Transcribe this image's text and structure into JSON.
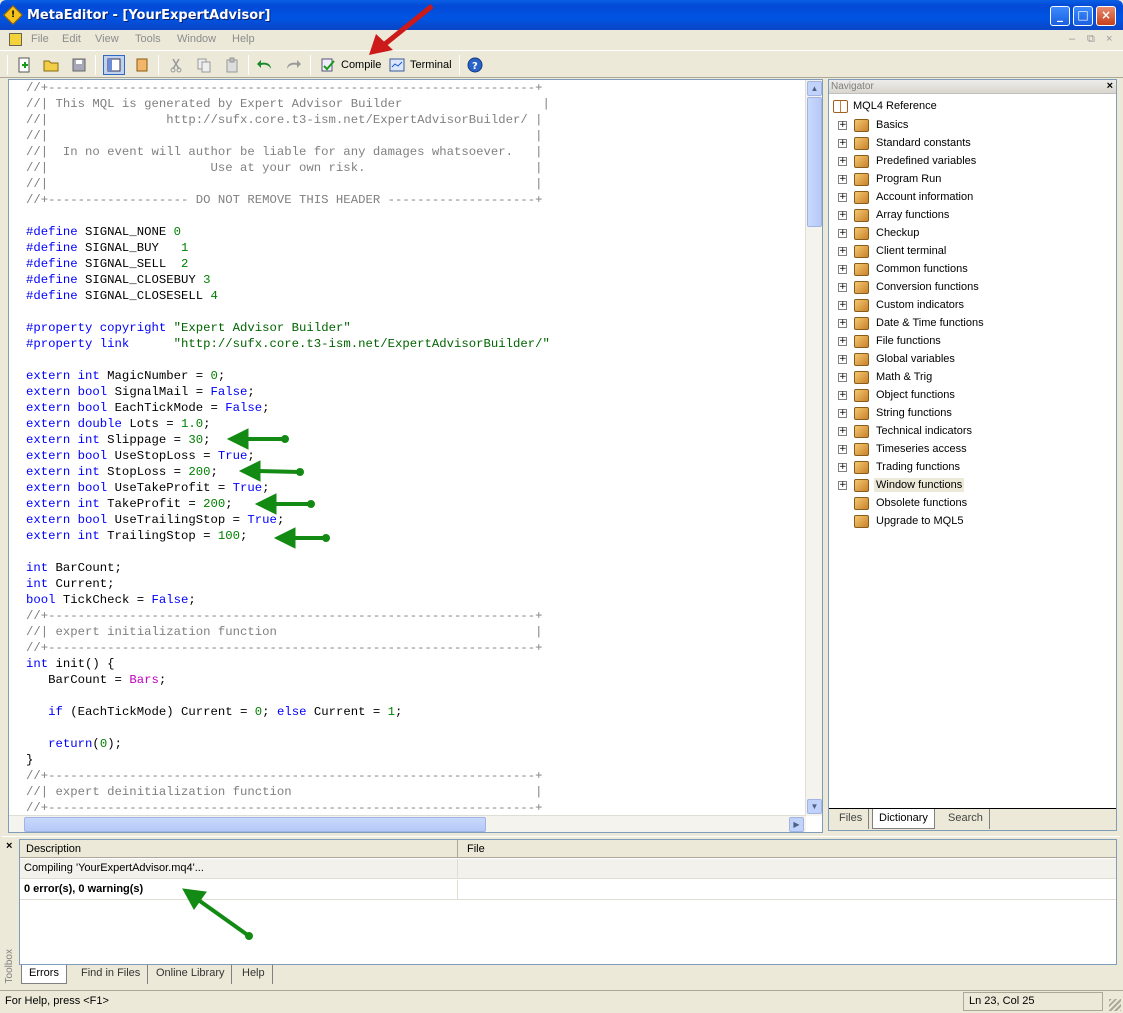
{
  "window": {
    "title": "MetaEditor - [YourExpertAdvisor]",
    "controls": [
      "_",
      "□",
      "×"
    ]
  },
  "menu": {
    "items": [
      "File",
      "Edit",
      "View",
      "Tools",
      "Window",
      "Help"
    ],
    "mdi_controls": [
      "–",
      "⧉",
      "×"
    ]
  },
  "toolbar": {
    "compile_label": "Compile",
    "terminal_label": "Terminal"
  },
  "editor": {
    "lines": [
      [
        [
          "cmt",
          "//+------------------------------------------------------------------+"
        ]
      ],
      [
        [
          "cmt",
          "//| This MQL is generated by Expert Advisor Builder                   |"
        ]
      ],
      [
        [
          "cmt",
          "//|                http://sufx.core.t3-ism.net/ExpertAdvisorBuilder/ |"
        ]
      ],
      [
        [
          "cmt",
          "//|                                                                  |"
        ]
      ],
      [
        [
          "cmt",
          "//|  In no event will author be liable for any damages whatsoever.   |"
        ]
      ],
      [
        [
          "cmt",
          "//|                      Use at your own risk.                       |"
        ]
      ],
      [
        [
          "cmt",
          "//|                                                                  |"
        ]
      ],
      [
        [
          "cmt",
          "//+------------------- DO NOT REMOVE THIS HEADER --------------------+"
        ]
      ],
      [],
      [
        [
          "pre",
          "#define"
        ],
        [
          "",
          " SIGNAL_NONE "
        ],
        [
          "num",
          "0"
        ]
      ],
      [
        [
          "pre",
          "#define"
        ],
        [
          "",
          " SIGNAL_BUY   "
        ],
        [
          "num",
          "1"
        ]
      ],
      [
        [
          "pre",
          "#define"
        ],
        [
          "",
          " SIGNAL_SELL  "
        ],
        [
          "num",
          "2"
        ]
      ],
      [
        [
          "pre",
          "#define"
        ],
        [
          "",
          " SIGNAL_CLOSEBUY "
        ],
        [
          "num",
          "3"
        ]
      ],
      [
        [
          "pre",
          "#define"
        ],
        [
          "",
          " SIGNAL_CLOSESELL "
        ],
        [
          "num",
          "4"
        ]
      ],
      [],
      [
        [
          "pre",
          "#property copyright"
        ],
        [
          "",
          " "
        ],
        [
          "str",
          "\"Expert Advisor Builder\""
        ]
      ],
      [
        [
          "pre",
          "#property link"
        ],
        [
          "",
          "      "
        ],
        [
          "str",
          "\"http://sufx.core.t3-ism.net/ExpertAdvisorBuilder/\""
        ]
      ],
      [],
      [
        [
          "kw",
          "extern int"
        ],
        [
          "",
          " MagicNumber = "
        ],
        [
          "num",
          "0"
        ],
        [
          "",
          ";"
        ]
      ],
      [
        [
          "kw",
          "extern bool"
        ],
        [
          "",
          " SignalMail = "
        ],
        [
          "bool",
          "False"
        ],
        [
          "",
          ";"
        ]
      ],
      [
        [
          "kw",
          "extern bool"
        ],
        [
          "",
          " EachTickMode = "
        ],
        [
          "bool",
          "False"
        ],
        [
          "",
          ";"
        ]
      ],
      [
        [
          "kw",
          "extern double"
        ],
        [
          "",
          " Lots = "
        ],
        [
          "num",
          "1.0"
        ],
        [
          "",
          ";"
        ]
      ],
      [
        [
          "kw",
          "extern int"
        ],
        [
          "",
          " Slippage = "
        ],
        [
          "num",
          "30"
        ],
        [
          "",
          ";"
        ]
      ],
      [
        [
          "kw",
          "extern bool"
        ],
        [
          "",
          " UseStopLoss = "
        ],
        [
          "bool",
          "True"
        ],
        [
          "",
          ";"
        ]
      ],
      [
        [
          "kw",
          "extern int"
        ],
        [
          "",
          " StopLoss = "
        ],
        [
          "num",
          "200"
        ],
        [
          "",
          ";"
        ]
      ],
      [
        [
          "kw",
          "extern bool"
        ],
        [
          "",
          " UseTakeProfit = "
        ],
        [
          "bool",
          "True"
        ],
        [
          "",
          ";"
        ]
      ],
      [
        [
          "kw",
          "extern int"
        ],
        [
          "",
          " TakeProfit = "
        ],
        [
          "num",
          "200"
        ],
        [
          "",
          ";"
        ]
      ],
      [
        [
          "kw",
          "extern bool"
        ],
        [
          "",
          " UseTrailingStop = "
        ],
        [
          "bool",
          "True"
        ],
        [
          "",
          ";"
        ]
      ],
      [
        [
          "kw",
          "extern int"
        ],
        [
          "",
          " TrailingStop = "
        ],
        [
          "num",
          "100"
        ],
        [
          "",
          ";"
        ]
      ],
      [],
      [
        [
          "kw",
          "int"
        ],
        [
          "",
          " BarCount;"
        ]
      ],
      [
        [
          "kw",
          "int"
        ],
        [
          "",
          " Current;"
        ]
      ],
      [
        [
          "kw",
          "bool"
        ],
        [
          "",
          " TickCheck = "
        ],
        [
          "bool",
          "False"
        ],
        [
          "",
          ";"
        ]
      ],
      [
        [
          "cmt",
          "//+------------------------------------------------------------------+"
        ]
      ],
      [
        [
          "cmt",
          "//| expert initialization function                                   |"
        ]
      ],
      [
        [
          "cmt",
          "//+------------------------------------------------------------------+"
        ]
      ],
      [
        [
          "kw",
          "int"
        ],
        [
          "",
          " init() {"
        ]
      ],
      [
        [
          "",
          "   BarCount = "
        ],
        [
          "var",
          "Bars"
        ],
        [
          "",
          ";"
        ]
      ],
      [],
      [
        [
          "",
          "   "
        ],
        [
          "kw",
          "if"
        ],
        [
          "",
          " (EachTickMode) Current = "
        ],
        [
          "num",
          "0"
        ],
        [
          "",
          "; "
        ],
        [
          "kw",
          "else"
        ],
        [
          "",
          " Current = "
        ],
        [
          "num",
          "1"
        ],
        [
          "",
          ";"
        ]
      ],
      [],
      [
        [
          "",
          "   "
        ],
        [
          "kw",
          "return"
        ],
        [
          "",
          "("
        ],
        [
          "num",
          "0"
        ],
        [
          "",
          ");"
        ]
      ],
      [
        [
          "",
          "}"
        ]
      ],
      [
        [
          "cmt",
          "//+------------------------------------------------------------------+"
        ]
      ],
      [
        [
          "cmt",
          "//| expert deinitialization function                                 |"
        ]
      ],
      [
        [
          "cmt",
          "//+------------------------------------------------------------------+"
        ]
      ]
    ]
  },
  "navigator": {
    "title": "Navigator",
    "root": "MQL4 Reference",
    "items": [
      {
        "label": "Basics",
        "expandable": true
      },
      {
        "label": "Standard constants",
        "expandable": true
      },
      {
        "label": "Predefined variables",
        "expandable": true
      },
      {
        "label": "Program Run",
        "expandable": true
      },
      {
        "label": "Account information",
        "expandable": true
      },
      {
        "label": "Array functions",
        "expandable": true
      },
      {
        "label": "Checkup",
        "expandable": true
      },
      {
        "label": "Client terminal",
        "expandable": true
      },
      {
        "label": "Common functions",
        "expandable": true
      },
      {
        "label": "Conversion functions",
        "expandable": true
      },
      {
        "label": "Custom indicators",
        "expandable": true
      },
      {
        "label": "Date & Time functions",
        "expandable": true
      },
      {
        "label": "File functions",
        "expandable": true
      },
      {
        "label": "Global variables",
        "expandable": true
      },
      {
        "label": "Math & Trig",
        "expandable": true
      },
      {
        "label": "Object functions",
        "expandable": true
      },
      {
        "label": "String functions",
        "expandable": true
      },
      {
        "label": "Technical indicators",
        "expandable": true
      },
      {
        "label": "Timeseries access",
        "expandable": true
      },
      {
        "label": "Trading functions",
        "expandable": true
      },
      {
        "label": "Window functions",
        "expandable": true,
        "selected": true
      },
      {
        "label": "Obsolete functions",
        "expandable": false
      },
      {
        "label": "Upgrade to MQL5",
        "expandable": false
      }
    ],
    "tabs": [
      "Files",
      "Dictionary",
      "Search"
    ],
    "active_tab": "Dictionary"
  },
  "toolbox": {
    "label": "Toolbox",
    "columns": [
      "Description",
      "File"
    ],
    "rows": [
      "Compiling 'YourExpertAdvisor.mq4'...",
      "0 error(s), 0 warning(s)"
    ],
    "tabs": [
      "Errors",
      "Find in Files",
      "Online Library",
      "Help"
    ],
    "active_tab": "Errors"
  },
  "statusbar": {
    "help": "For Help, press <F1>",
    "position": "Ln 23, Col 25"
  },
  "colors": {
    "comment": "#808080",
    "keyword": "#0000ff",
    "number": "#008000",
    "string": "#006400",
    "predefined_var": "#c000c0",
    "annotation_red": "#cc1a1a",
    "annotation_green": "#138a13"
  }
}
